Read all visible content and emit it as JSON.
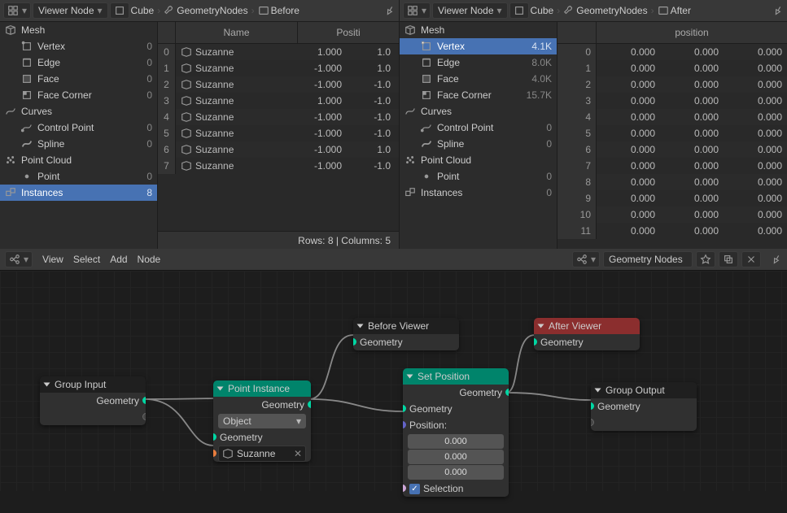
{
  "left": {
    "header": {
      "mode": "Viewer Node",
      "object": "Cube",
      "modifier": "GeometryNodes",
      "viewer": "Before"
    },
    "domains": {
      "mesh_label": "Mesh",
      "vertex": "Vertex",
      "vertex_n": "0",
      "edge": "Edge",
      "edge_n": "0",
      "face": "Face",
      "face_n": "0",
      "corner": "Face Corner",
      "corner_n": "0",
      "curves_label": "Curves",
      "cp": "Control Point",
      "cp_n": "0",
      "spline": "Spline",
      "spline_n": "0",
      "pc_label": "Point Cloud",
      "point": "Point",
      "point_n": "0",
      "inst": "Instances",
      "inst_n": "8"
    },
    "columns": {
      "name": "Name",
      "pos": "Positi"
    },
    "rows": [
      {
        "i": "0",
        "name": "Suzanne",
        "p0": "1.000",
        "p1": "1.0"
      },
      {
        "i": "1",
        "name": "Suzanne",
        "p0": "-1.000",
        "p1": "1.0"
      },
      {
        "i": "2",
        "name": "Suzanne",
        "p0": "-1.000",
        "p1": "-1.0"
      },
      {
        "i": "3",
        "name": "Suzanne",
        "p0": "1.000",
        "p1": "-1.0"
      },
      {
        "i": "4",
        "name": "Suzanne",
        "p0": "-1.000",
        "p1": "-1.0"
      },
      {
        "i": "5",
        "name": "Suzanne",
        "p0": "-1.000",
        "p1": "-1.0"
      },
      {
        "i": "6",
        "name": "Suzanne",
        "p0": "-1.000",
        "p1": "1.0"
      },
      {
        "i": "7",
        "name": "Suzanne",
        "p0": "-1.000",
        "p1": "-1.0"
      }
    ],
    "status": "Rows: 8   |   Columns: 5"
  },
  "right": {
    "header": {
      "mode": "Viewer Node",
      "object": "Cube",
      "modifier": "GeometryNodes",
      "viewer": "After"
    },
    "domains": {
      "mesh_label": "Mesh",
      "vertex": "Vertex",
      "vertex_n": "4.1K",
      "edge": "Edge",
      "edge_n": "8.0K",
      "face": "Face",
      "face_n": "4.0K",
      "corner": "Face Corner",
      "corner_n": "15.7K",
      "curves_label": "Curves",
      "cp": "Control Point",
      "cp_n": "0",
      "spline": "Spline",
      "spline_n": "0",
      "pc_label": "Point Cloud",
      "point": "Point",
      "point_n": "0",
      "inst": "Instances",
      "inst_n": "0"
    },
    "column": "position",
    "rows": [
      {
        "i": "0",
        "a": "0.000",
        "b": "0.000",
        "c": "0.000"
      },
      {
        "i": "1",
        "a": "0.000",
        "b": "0.000",
        "c": "0.000"
      },
      {
        "i": "2",
        "a": "0.000",
        "b": "0.000",
        "c": "0.000"
      },
      {
        "i": "3",
        "a": "0.000",
        "b": "0.000",
        "c": "0.000"
      },
      {
        "i": "4",
        "a": "0.000",
        "b": "0.000",
        "c": "0.000"
      },
      {
        "i": "5",
        "a": "0.000",
        "b": "0.000",
        "c": "0.000"
      },
      {
        "i": "6",
        "a": "0.000",
        "b": "0.000",
        "c": "0.000"
      },
      {
        "i": "7",
        "a": "0.000",
        "b": "0.000",
        "c": "0.000"
      },
      {
        "i": "8",
        "a": "0.000",
        "b": "0.000",
        "c": "0.000"
      },
      {
        "i": "9",
        "a": "0.000",
        "b": "0.000",
        "c": "0.000"
      },
      {
        "i": "10",
        "a": "0.000",
        "b": "0.000",
        "c": "0.000"
      },
      {
        "i": "11",
        "a": "0.000",
        "b": "0.000",
        "c": "0.000"
      }
    ]
  },
  "ned": {
    "menus": {
      "view": "View",
      "select": "Select",
      "add": "Add",
      "node": "Node"
    },
    "tree_name": "Geometry Nodes",
    "nodes": {
      "group_input": {
        "title": "Group Input",
        "geo": "Geometry"
      },
      "before_viewer": {
        "title": "Before Viewer",
        "geo": "Geometry"
      },
      "point_instance": {
        "title": "Point Instance",
        "out_geo": "Geometry",
        "in_geo": "Geometry",
        "mode": "Object",
        "obj": "Suzanne"
      },
      "set_position": {
        "title": "Set Position",
        "out_geo": "Geometry",
        "in_geo": "Geometry",
        "pos_label": "Position:",
        "p0": "0.000",
        "p1": "0.000",
        "p2": "0.000",
        "sel": "Selection"
      },
      "after_viewer": {
        "title": "After Viewer",
        "geo": "Geometry"
      },
      "group_output": {
        "title": "Group Output",
        "geo": "Geometry"
      }
    }
  }
}
